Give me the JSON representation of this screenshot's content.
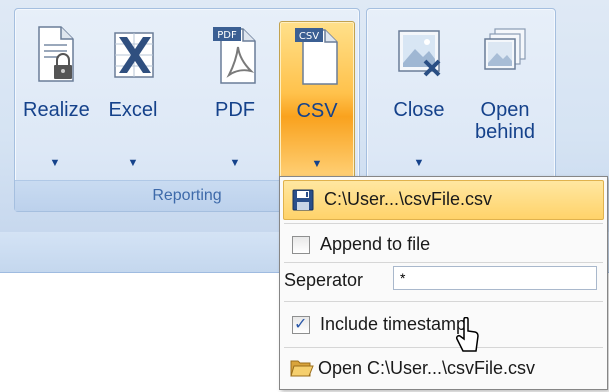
{
  "ribbon": {
    "groups": [
      {
        "label": "Reporting",
        "buttons": [
          {
            "label": "Realize",
            "icon": "lock-document-icon",
            "has_dropdown": true
          },
          {
            "label": "Excel",
            "icon": "excel-icon",
            "has_dropdown": true
          },
          {
            "label": "PDF",
            "icon": "pdf-icon",
            "has_dropdown": true,
            "badge": "PDF"
          },
          {
            "label": "CSV",
            "icon": "csv-icon",
            "has_dropdown": true,
            "badge": "CSV",
            "active": true
          }
        ]
      },
      {
        "label": "",
        "buttons": [
          {
            "label": "Close",
            "icon": "close-image-icon",
            "has_dropdown": true
          },
          {
            "label_line1": "Open",
            "label_line2": "behind",
            "icon": "open-behind-icon",
            "has_dropdown": false
          }
        ]
      }
    ]
  },
  "csv_menu": {
    "file_path": "C:\\User...\\csvFile.csv",
    "append_label": "Append to file",
    "append_checked": false,
    "separator_label": "Seperator",
    "separator_value": "*",
    "timestamp_label": "Include timestamp",
    "timestamp_checked": true,
    "open_label": "Open C:\\User...\\csvFile.csv"
  },
  "colors": {
    "accent_orange": "#ffc24c",
    "ribbon_text": "#15428b",
    "ribbon_bg": "#dfe9f5"
  }
}
